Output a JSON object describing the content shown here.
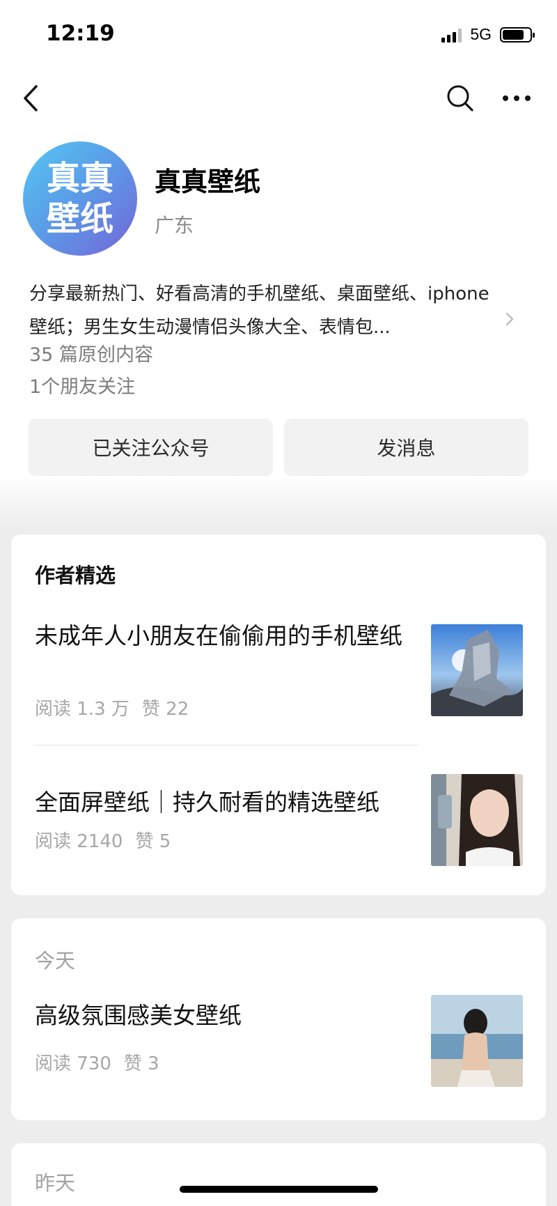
{
  "status_bar": {
    "time": "12:19",
    "network": "5G"
  },
  "account": {
    "avatar_text_line1": "真真",
    "avatar_text_line2": "壁纸",
    "name": "真真壁纸",
    "region": "广东",
    "description": "分享最新热门、好看高清的手机壁纸、桌面壁纸、iphone壁纸；男生女生动漫情侣头像大全、表情包...",
    "original_count": "35 篇原创内容",
    "friends_following": "1个朋友关注"
  },
  "actions": {
    "follow": "已关注公众号",
    "message": "发消息"
  },
  "featured": {
    "title": "作者精选",
    "articles": [
      {
        "title": "未成年人小朋友在偷偷用的手机壁纸",
        "reads": "阅读 1.3 万",
        "likes": "赞 22"
      },
      {
        "title": "全面屏壁纸｜持久耐看的精选壁纸",
        "reads": "阅读 2140",
        "likes": "赞 5"
      }
    ]
  },
  "today": {
    "title": "今天",
    "articles": [
      {
        "title": "高级氛围感美女壁纸",
        "reads": "阅读 730",
        "likes": "赞 3"
      }
    ]
  },
  "yesterday": {
    "title": "昨天"
  }
}
